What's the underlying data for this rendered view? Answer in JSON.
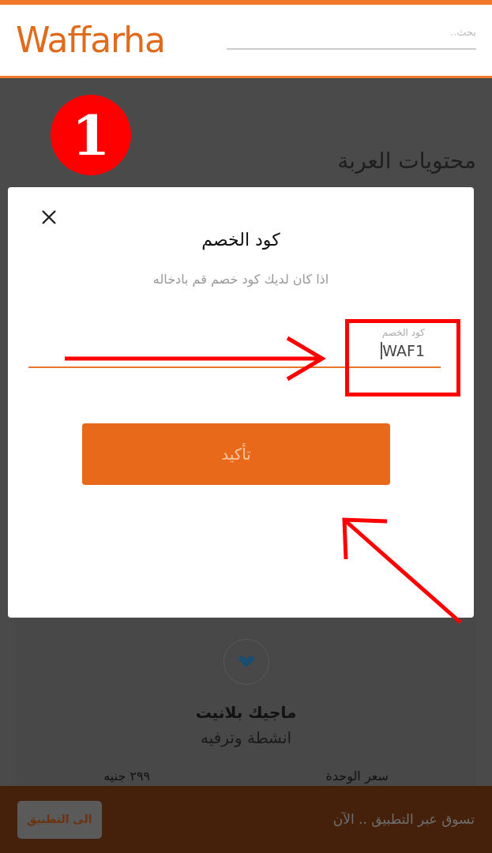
{
  "header": {
    "logo": "Waffarha",
    "search": {
      "placeholder": "بحث.."
    }
  },
  "annotation": {
    "step": "1"
  },
  "page_title": "محتويات العربة",
  "product": {
    "name": "ماجيك بلانيت",
    "category": "انشطة وترفيه",
    "price_label": "سعر الوحدة",
    "price": "٢٩٩ جنيه"
  },
  "dialog": {
    "title": "كود الخصم",
    "message": "اذا كان لديك كود خصم قم بادخاله",
    "field": {
      "label": "كود الخصم",
      "value": "WAF1",
      "focused": true
    },
    "confirm_button": "تأكيد"
  },
  "app_banner": {
    "text": "تسوق عبر التطبيق .. الآن",
    "button": "الى التطبيق"
  }
}
